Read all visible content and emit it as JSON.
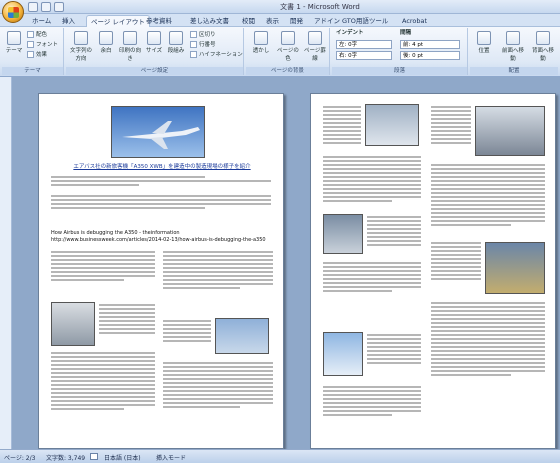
{
  "window": {
    "title": "文書 1 - Microsoft Word"
  },
  "tabs": [
    "ホーム",
    "挿入",
    "ページ レイアウト",
    "参考資料",
    "差し込み文書",
    "校閲",
    "表示",
    "開発",
    "アドイン",
    "GTO用語ツール",
    "Acrobat"
  ],
  "ribbon": {
    "theme": {
      "label": "テーマ",
      "buttons": [
        "テーマ"
      ],
      "rows": [
        "配色",
        "フォント",
        "効果"
      ]
    },
    "page_setup": {
      "label": "ページ設定",
      "buttons": [
        "文字列の方向",
        "余白",
        "印刷の向き",
        "サイズ",
        "段組み"
      ],
      "rows": [
        "区切り",
        "行番号",
        "ハイフネーション"
      ]
    },
    "background": {
      "label": "ページの背景",
      "buttons": [
        "透かし",
        "ページの色",
        "ページ罫線"
      ]
    },
    "paragraph": {
      "label": "段落",
      "indent_title": "インデント",
      "spacing_title": "間隔",
      "left": "左: 0字",
      "right": "右: 0字",
      "before": "前: 4 pt",
      "after": "後: 0 pt"
    },
    "arrange": {
      "label": "配置",
      "buttons": [
        "位置",
        "前面へ移動",
        "背面へ移動"
      ]
    }
  },
  "article": {
    "headline": "エアバス社の新旅客機「A350 XWB」を建造中の製造現場の様子を紹介",
    "url_label": "How Airbus is debugging the A350 - theinformation",
    "url": "http://www.businessweek.com/articles/2014-02-13/how-airbus-is-debugging-the-a350"
  },
  "status": {
    "page": "ページ: 2/3",
    "words": "文字数: 3,749",
    "lang": "日本語 (日本)",
    "mode": "挿入モード"
  }
}
